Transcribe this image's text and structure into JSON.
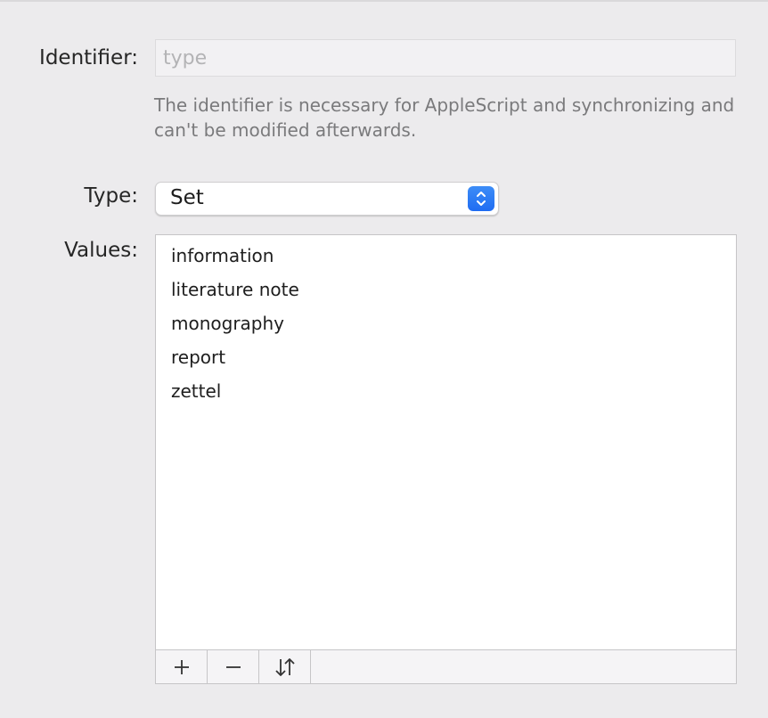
{
  "identifier": {
    "label": "Identifier:",
    "placeholder": "type",
    "help_text": "The identifier is necessary for AppleScript and synchronizing and can't be modified afterwards."
  },
  "type": {
    "label": "Type:",
    "selected": "Set"
  },
  "values": {
    "label": "Values:",
    "items": [
      "information",
      "literature note",
      "monography",
      "report",
      "zettel"
    ]
  },
  "toolbar": {
    "add_icon": "plus-icon",
    "remove_icon": "minus-icon",
    "sort_icon": "sort-arrows-icon"
  },
  "colors": {
    "accent": "#2A7CF6",
    "background": "#ECEBED"
  }
}
